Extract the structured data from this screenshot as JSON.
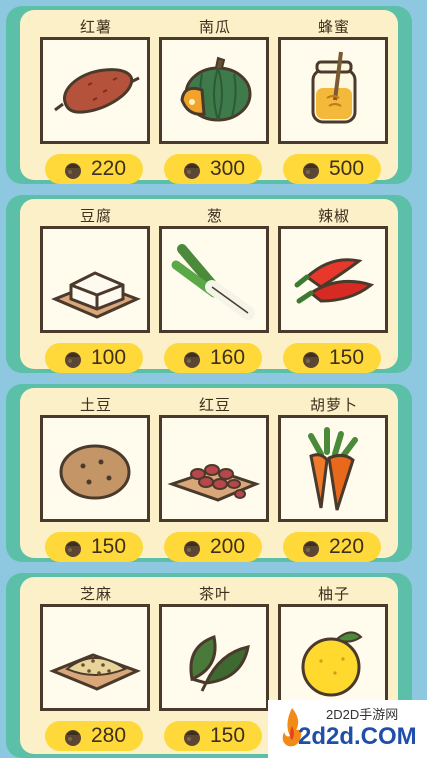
{
  "shop": {
    "sections": [
      {
        "items": [
          {
            "name": "红薯",
            "price": "220",
            "icon": "sweet-potato-icon"
          },
          {
            "name": "南瓜",
            "price": "300",
            "icon": "pumpkin-icon"
          },
          {
            "name": "蜂蜜",
            "price": "500",
            "icon": "honey-jar-icon"
          }
        ]
      },
      {
        "items": [
          {
            "name": "豆腐",
            "price": "100",
            "icon": "tofu-icon"
          },
          {
            "name": "葱",
            "price": "160",
            "icon": "green-onion-icon"
          },
          {
            "name": "辣椒",
            "price": "150",
            "icon": "chili-pepper-icon"
          }
        ]
      },
      {
        "items": [
          {
            "name": "土豆",
            "price": "150",
            "icon": "potato-icon"
          },
          {
            "name": "红豆",
            "price": "200",
            "icon": "red-beans-icon"
          },
          {
            "name": "胡萝卜",
            "price": "220",
            "icon": "carrot-icon"
          }
        ]
      },
      {
        "items": [
          {
            "name": "芝麻",
            "price": "280",
            "icon": "sesame-icon"
          },
          {
            "name": "茶叶",
            "price": "150",
            "icon": "tea-leaves-icon"
          },
          {
            "name": "柚子",
            "price": "",
            "icon": "pomelo-icon"
          }
        ]
      }
    ],
    "currency_icon": "acorn-coin-icon"
  },
  "watermark": {
    "subtitle": "2D2D手游网",
    "domain": "2d2d.COM"
  },
  "colors": {
    "background": "#8ec8e0",
    "panel_border": "#5cc0a8",
    "panel_fill": "#fbf0c8",
    "price_pill": "#ffd83a",
    "frame_border": "#4a3a2c"
  }
}
